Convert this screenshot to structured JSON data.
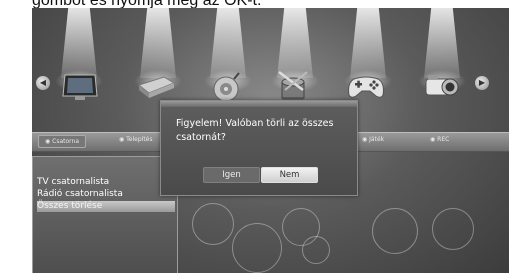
{
  "document": {
    "caption_fragment": "gombot és nyomja meg az OK-t."
  },
  "menu": {
    "tabs": [
      {
        "label": "Csatorna",
        "active": true
      },
      {
        "label": "Telepítés",
        "active": false
      },
      {
        "label": "Játék",
        "active": false
      },
      {
        "label": "REC",
        "active": false
      }
    ],
    "icons": [
      "tv-icon",
      "receiver-icon",
      "satellite-dish-icon",
      "tools-icon",
      "gamepad-icon",
      "camcorder-icon"
    ]
  },
  "submenu": {
    "items": [
      {
        "label": "TV csatornalista",
        "selected": false
      },
      {
        "label": "Rádió csatornalista",
        "selected": false
      },
      {
        "label": "Összes törlése",
        "selected": true
      }
    ]
  },
  "dialog": {
    "message": "Figyelem! Valóban törli az összes csatornát?",
    "yes_label": "Igen",
    "no_label": "Nem",
    "focused": "Nem"
  }
}
